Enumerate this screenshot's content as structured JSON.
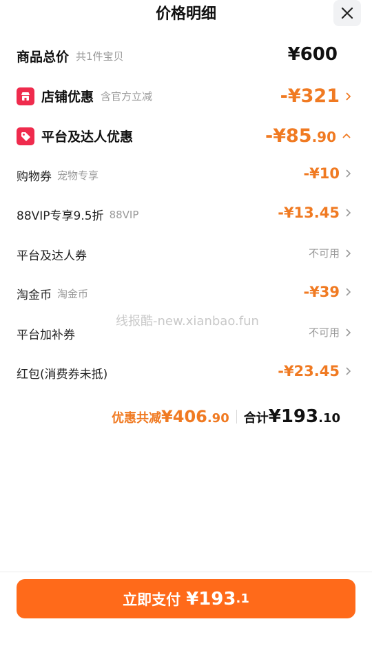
{
  "header": {
    "title": "价格明细",
    "close_icon": "close-icon"
  },
  "subtotal": {
    "label": "商品总价",
    "sub": "共1件宝贝",
    "amount": "¥600"
  },
  "shop_discount": {
    "label": "店铺优惠",
    "sub": "含官方立减",
    "amount": "-¥321",
    "icon": "store-icon",
    "icon_color": "#ef2b4d"
  },
  "platform_discount": {
    "label": "平台及达人优惠",
    "amount": "-¥85",
    "amount_decimal": ".90",
    "icon": "tag-icon",
    "icon_color": "#ef2b4d"
  },
  "items": [
    {
      "label": "购物券",
      "sub": "宠物专享",
      "value": "-¥10"
    },
    {
      "label": "88VIP专享9.5折",
      "sub": "88VIP",
      "value": "-¥13.45"
    },
    {
      "label": "平台及达人券",
      "sub": "",
      "value": "不可用"
    },
    {
      "label": "淘金币",
      "sub": "淘金币",
      "value": "-¥39"
    },
    {
      "label": "平台加补券",
      "sub": "",
      "value": "不可用"
    },
    {
      "label": "红包(消费券未抵)",
      "sub": "",
      "value": "-¥23.45"
    }
  ],
  "watermark": "线报酷-new.xianbao.fun",
  "summary": {
    "discount_label": "优惠共减",
    "discount_amount": "¥406",
    "discount_decimal": ".90",
    "total_label": "合计",
    "total_amount": "¥193",
    "total_decimal": ".10"
  },
  "pay_button": {
    "label": "立即支付",
    "amount": "¥193",
    "decimal": ".1"
  },
  "colors": {
    "accent_orange": "#f07a22",
    "pay_button": "#ff6a1a",
    "badge_red": "#ef2b4d"
  }
}
